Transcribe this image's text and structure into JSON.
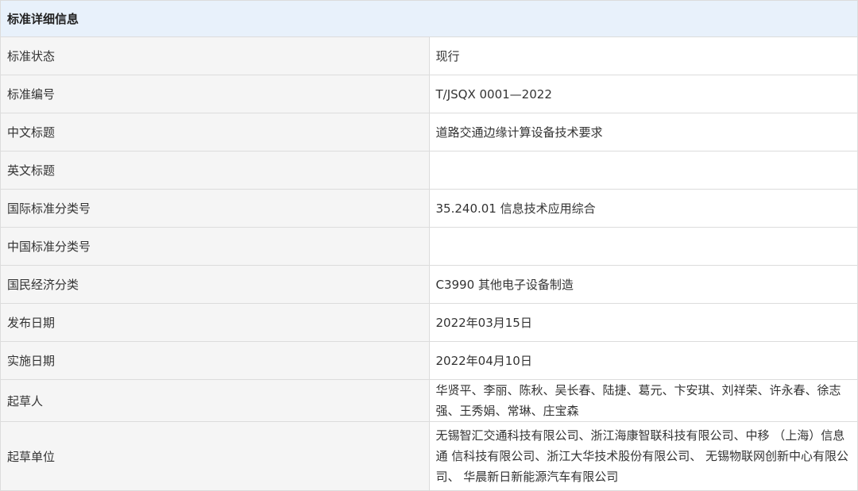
{
  "header": {
    "title": "标准详细信息"
  },
  "rows": [
    {
      "label": "标准状态",
      "value": "现行"
    },
    {
      "label": "标准编号",
      "value": "T/JSQX 0001—2022"
    },
    {
      "label": "中文标题",
      "value": "道路交通边缘计算设备技术要求"
    },
    {
      "label": "英文标题",
      "value": ""
    },
    {
      "label": "国际标准分类号",
      "value": "35.240.01 信息技术应用综合"
    },
    {
      "label": "中国标准分类号",
      "value": ""
    },
    {
      "label": "国民经济分类",
      "value": "C3990 其他电子设备制造"
    },
    {
      "label": "发布日期",
      "value": "2022年03月15日"
    },
    {
      "label": "实施日期",
      "value": "2022年04月10日"
    },
    {
      "label": "起草人",
      "value": "华贤平、李丽、陈秋、吴长春、陆捷、葛元、卞安琪、刘祥荣、许永春、徐志 强、王秀娟、常琳、庄宝森"
    },
    {
      "label": "起草单位",
      "value": "无锡智汇交通科技有限公司、浙江海康智联科技有限公司、中移 （上海）信息通 信科技有限公司、浙江大华技术股份有限公司、 无锡物联网创新中心有限公司、 华晨新日新能源汽车有限公司"
    }
  ]
}
